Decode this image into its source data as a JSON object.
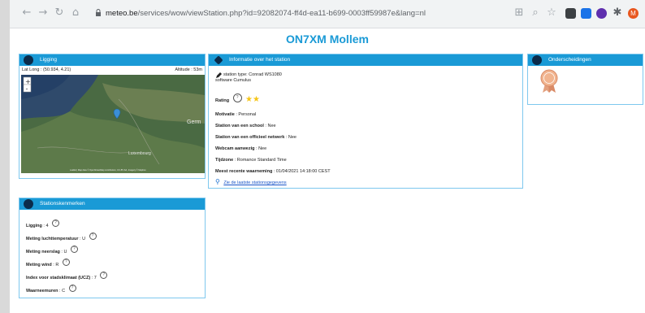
{
  "browser": {
    "url_host": "meteo.be",
    "url_path": "/services/wow/viewStation.php?id=92082074-ff4d-ea11-b699-0003ff59987e&lang=nl",
    "profile_initial": "M"
  },
  "page": {
    "title": "ON7XM Mollem"
  },
  "ligging": {
    "header": "Ligging",
    "latlong_label": "Lat Long : (50.934, 4.21)",
    "altitude_label": "Altitude : 53m",
    "map_labels": [
      "Germ",
      "Luxembourg"
    ],
    "map_credit": "Leaflet | Map data © OpenStreetMap contributors, CC-BY-SA, Imagery © Mapbox"
  },
  "info": {
    "header": "Informatie over het station",
    "station_type": "station type: Conrad WS1080",
    "software": "software Cumulus",
    "rating_label": "Rating",
    "rating_stars": 2,
    "rows": [
      {
        "label": "Motivatie",
        "value": " : Personal"
      },
      {
        "label": "Station van een school",
        "value": " : Nee"
      },
      {
        "label": "Station van een officieel netwerk",
        "value": " : Nee"
      },
      {
        "label": "Webcam aanwezig",
        "value": " : Nee"
      },
      {
        "label": "Tijdzone",
        "value": " : Romance Standard Time"
      },
      {
        "label": "Meest recente waarneming",
        "value": " : 01/04/2021 14:18:00 CEST"
      }
    ],
    "link": "Zie de laatste stationsgegevens"
  },
  "onderscheidingen": {
    "header": "Onderscheidingen"
  },
  "kenmerken": {
    "header": "Stationskenmerken",
    "rows": [
      {
        "label": "Ligging",
        "value": " : 4"
      },
      {
        "label": "Meting luchttemperatuur",
        "value": " : U"
      },
      {
        "label": "Meting neerslag",
        "value": " : U"
      },
      {
        "label": "Meting wind",
        "value": " : R"
      },
      {
        "label": "Index voor stadsklimaat (UCZ)",
        "value": " : 7"
      },
      {
        "label": "Waarneemuren",
        "value": " : C"
      }
    ]
  },
  "colors": {
    "accent": "#1a9ad6",
    "border": "#7ec8ee",
    "star": "#f5c518"
  }
}
